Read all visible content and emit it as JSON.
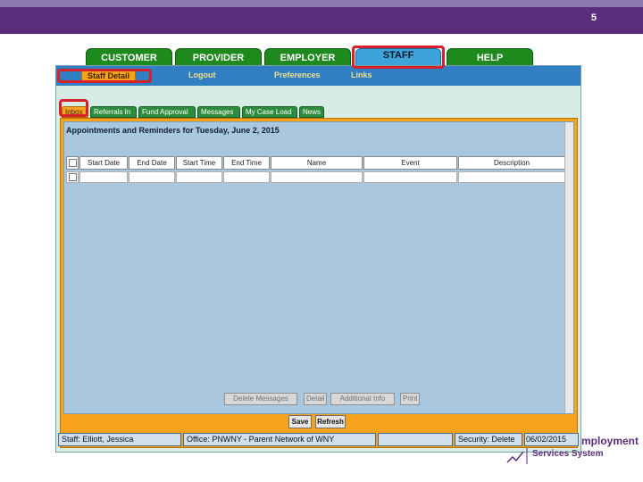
{
  "slide": {
    "number": "5"
  },
  "main_tabs": [
    {
      "label": "CUSTOMER"
    },
    {
      "label": "PROVIDER"
    },
    {
      "label": "EMPLOYER"
    },
    {
      "label": "STAFF"
    },
    {
      "label": "HELP"
    }
  ],
  "subnav": [
    {
      "label": "Staff Detail"
    },
    {
      "label": "Logout"
    },
    {
      "label": "Preferences"
    },
    {
      "label": "Links"
    }
  ],
  "inbox_tabs": [
    {
      "label": "Inbox"
    },
    {
      "label": "Referrals In"
    },
    {
      "label": "Fund Approval"
    },
    {
      "label": "Messages"
    },
    {
      "label": "My Case Load"
    },
    {
      "label": "News"
    }
  ],
  "appointments": {
    "title": "Appointments and Reminders for Tuesday, June 2, 2015"
  },
  "table": {
    "columns": [
      "Start Date",
      "End Date",
      "Start Time",
      "End Time",
      "Name",
      "Event",
      "Description"
    ]
  },
  "actions": {
    "delete_messages": "Delete Messages",
    "detail": "Detail",
    "additional_info": "Additional Info",
    "print": "Print",
    "save": "Save",
    "refresh": "Refresh"
  },
  "status": {
    "staff": "Staff: Elliott, Jessica",
    "office": "Office: PNWNY - Parent Network of WNY",
    "security": "Security: Delete",
    "date": "06/02/2015"
  },
  "logo": {
    "line1": "mployment",
    "line2": "Services System"
  },
  "colors": {
    "header_purple": "#5b2d7a",
    "tab_green": "#1e8a1e",
    "accent_orange": "#f6a21c",
    "highlight_red": "#d8202a"
  }
}
